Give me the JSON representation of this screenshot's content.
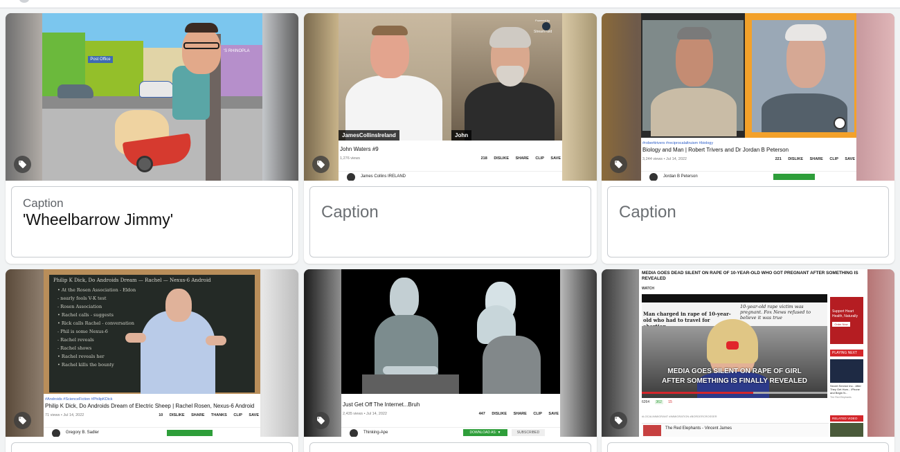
{
  "cards": [
    {
      "caption_label": "Caption",
      "caption_value": "'Wheelbarrow Jimmy'",
      "thumb_text": "Post Office",
      "thumb_text2": "'S RHINOPLA"
    },
    {
      "caption_placeholder": "Caption",
      "thumb_badge": "StreamYard",
      "thumb_badge_top": "Powered by",
      "thumb_name_left": "JamesCollinsIreland",
      "thumb_name_right": "John",
      "yt_title": "John Waters #9",
      "yt_views": "1,276 views",
      "yt_actions": [
        "218",
        "DISLIKE",
        "SHARE",
        "CLIP",
        "SAVE"
      ],
      "yt_channel": "James Collins IRELAND"
    },
    {
      "caption_placeholder": "Caption",
      "yt_tags": "#roberttrivers #reciprocalaltruism #biology",
      "yt_title": "Biology and Man | Robert Trivers and Dr Jordan B Peterson",
      "yt_views": "3,244 views • Jul 14, 2022",
      "yt_actions": [
        "221",
        "DISLIKE",
        "SHARE",
        "CLIP",
        "SAVE"
      ],
      "yt_channel": "Jordan B Peterson"
    },
    {
      "yt_tags": "#Androids #ScienceFiction #PhilipKDick",
      "yt_title": "Philip K Dick, Do Androids Dream of Electric Sheep | Rachel Rosen, Nexus-6 Android",
      "yt_views": "71 views • Jul 14, 2022",
      "yt_actions": [
        "10",
        "DISLIKE",
        "SHARE",
        "THANKS",
        "CLIP",
        "SAVE"
      ],
      "yt_channel": "Gregory B. Sadler",
      "board_title": "Philip K Dick, Do Androids Dream — Rachel — Nexus-6 Android",
      "board_lines": [
        "• At the Rosen Association - Eldon",
        "  - nearly fools V-K test",
        "  - Rosen Association",
        "• Rachel calls - suggests",
        "• Rick calls Rachel - conversation",
        "  - Phil is some Nexus-6",
        "  - Rachel reveals",
        "  - Rachel shows",
        "• Rachel reveals her",
        "• Rachel kills the bounty"
      ]
    },
    {
      "yt_title": "Just Get Off The Internet...Bruh",
      "yt_views": "2,435 views • Jul 14, 2022",
      "yt_actions": [
        "447",
        "DISLIKE",
        "SHARE",
        "CLIP",
        "SAVE"
      ],
      "yt_channel": "Thinking-Ape",
      "yt_download": "DOWNLOAD AS: ▼",
      "yt_subscribed": "SUBSCRIBED"
    },
    {
      "headline": "MEDIA GOES DEAD SILENT ON RAPE OF 10-YEAR-OLD WHO GOT PREGNANT AFTER SOMETHING IS REVEALED",
      "watch": "WATCH",
      "article_head1": "Man charged in rape of 10-year-old who had to travel for abortion",
      "article_head2": "10-year-old rape victim was pregnant. Fox News refused to believe it was true",
      "banner1": "MEDIA GOES SILENT ON RAPE OF GIRL",
      "banner2": "AFTER SOMETHING IS FINALLY REVEALED",
      "ad_text": "Support Heart Health, Naturally",
      "ad_btn": "Order Now",
      "playing_next": "PLAYING NEXT",
      "related": "RELATED VIDEO",
      "side_item": "Secret Service Inv... After They Get Hum... iPhone and Begin N...",
      "side_item_ch": "The Red Elephants",
      "views": "6264",
      "likes": "362",
      "dislikes": "15",
      "channel": "The Red Elephants - Vincent James",
      "tags_row": "#LOCALIMMIGRANT #IMMIGRATION #BORDERCROSSER"
    }
  ],
  "colors": {
    "accent_green": "#2e9e3a",
    "yt_link": "#3060c8",
    "news_red": "#d4262b"
  }
}
